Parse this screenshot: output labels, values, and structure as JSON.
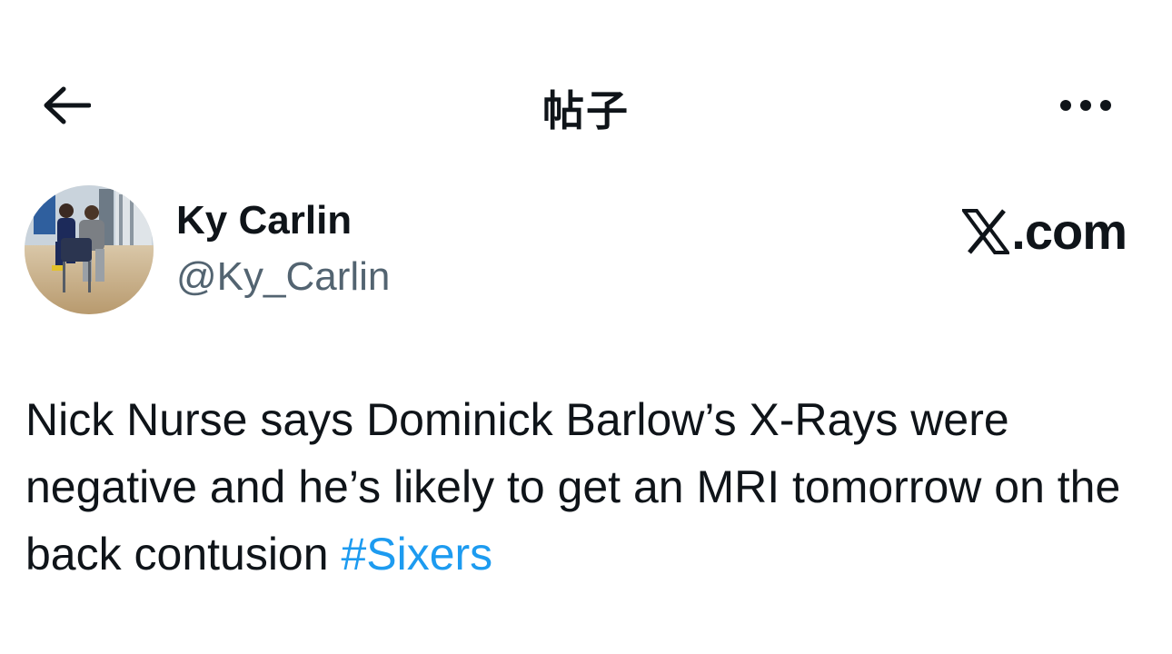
{
  "header": {
    "title": "帖子",
    "back_icon": "arrow-left-icon",
    "more_icon": "more-horizontal-icon"
  },
  "author": {
    "name": "Ky Carlin",
    "handle": "@Ky_Carlin",
    "avatar": "avatar-photo"
  },
  "brand": {
    "logo_icon": "x-logo-icon",
    "domain": ".com"
  },
  "tweet": {
    "text": "Nick Nurse says Dominick Barlow’s X-Rays were negative and he’s likely to get an MRI tomorrow on the back contusion",
    "hashtag": "#Sixers"
  },
  "colors": {
    "text": "#0f1419",
    "secondary_text": "#536471",
    "link": "#1d9bf0",
    "background": "#ffffff"
  }
}
